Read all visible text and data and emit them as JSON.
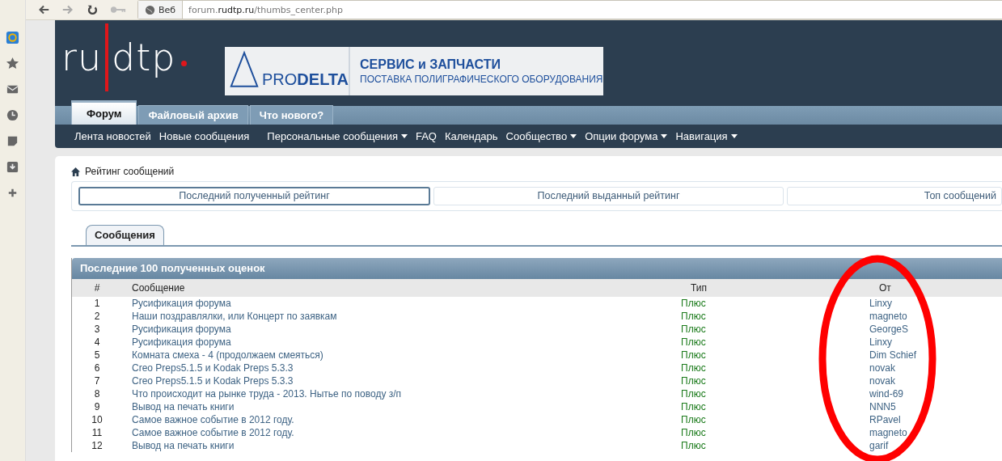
{
  "browser": {
    "site_label": "Веб",
    "url_prefix": "forum.",
    "url_domain": "rudtp.ru",
    "url_path": "/thumbs_center.php"
  },
  "logo": {
    "left": "ru",
    "right": "dtp"
  },
  "banner": {
    "brand_light": "PRO",
    "brand_bold": "DELTA",
    "headline": "СЕРВИС и ЗАПЧАСТИ",
    "subline": "ПОСТАВКА ПОЛИГРАФИЧЕСКОГО ОБОРУДОВАНИЯ"
  },
  "main_tabs": [
    {
      "label": "Форум",
      "selected": true
    },
    {
      "label": "Файловый архив",
      "selected": false
    },
    {
      "label": "Что нового?",
      "selected": false
    }
  ],
  "nav_groups": [
    [
      {
        "label": "Лента новостей",
        "dropdown": false
      },
      {
        "label": "Новые сообщения",
        "dropdown": false
      }
    ],
    [
      {
        "label": "Персональные сообщения",
        "dropdown": true
      },
      {
        "label": "FAQ",
        "dropdown": false
      },
      {
        "label": "Календарь",
        "dropdown": false
      },
      {
        "label": "Сообщество",
        "dropdown": true
      },
      {
        "label": "Опции форума",
        "dropdown": true
      },
      {
        "label": "Навигация",
        "dropdown": true
      }
    ]
  ],
  "breadcrumb": "Рейтинг сообщений",
  "rating_tabs": [
    {
      "label": "Последний полученный рейтинг",
      "selected": true
    },
    {
      "label": "Последний выданный рейтинг",
      "selected": false
    },
    {
      "label": "Топ сообщений",
      "selected": false
    }
  ],
  "section_tab": "Сообщения",
  "table": {
    "title": "Последние 100 полученных оценок",
    "columns": [
      "#",
      "Сообщение",
      "Тип",
      "От"
    ],
    "rows": [
      {
        "n": "1",
        "message": "Русификация форума",
        "type": "Плюс",
        "from": "Linxy"
      },
      {
        "n": "2",
        "message": "Наши поздравлялки, или Концерт по заявкам",
        "type": "Плюс",
        "from": "magneto"
      },
      {
        "n": "3",
        "message": "Русификация форума",
        "type": "Плюс",
        "from": "GeorgeS"
      },
      {
        "n": "4",
        "message": "Русификация форума",
        "type": "Плюс",
        "from": "Linxy"
      },
      {
        "n": "5",
        "message": "Комната смеха - 4 (продолжаем смеяться)",
        "type": "Плюс",
        "from": "Dim Schief"
      },
      {
        "n": "6",
        "message": "Creo Preps5.1.5 и Kodak Preps 5.3.3",
        "type": "Плюс",
        "from": "novak"
      },
      {
        "n": "7",
        "message": "Creo Preps5.1.5 и Kodak Preps 5.3.3",
        "type": "Плюс",
        "from": "novak"
      },
      {
        "n": "8",
        "message": "Что происходит на рынке труда - 2013. Нытье по поводу з/п",
        "type": "Плюс",
        "from": "wind-69"
      },
      {
        "n": "9",
        "message": "Вывод на печать книги",
        "type": "Плюс",
        "from": "NNN5"
      },
      {
        "n": "10",
        "message": "Самое важное событие в 2012 году.",
        "type": "Плюс",
        "from": "RPavel"
      },
      {
        "n": "11",
        "message": "Самое важное событие в 2012 году.",
        "type": "Плюс",
        "from": "magneto"
      },
      {
        "n": "12",
        "message": "Вывод на печать книги",
        "type": "Плюс",
        "from": "garif"
      }
    ]
  }
}
